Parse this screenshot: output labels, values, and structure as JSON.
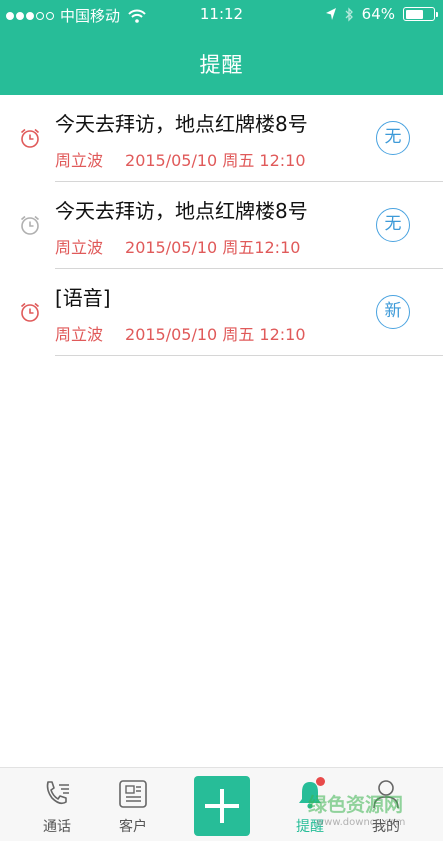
{
  "status_bar": {
    "carrier": "中国移动",
    "time": "11:12",
    "battery": "64%",
    "battery_level": 0.64,
    "signal_dots_on": 3,
    "signal_dots_total": 5
  },
  "header": {
    "title": "提醒"
  },
  "reminders": [
    {
      "title": "今天去拜访，地点红牌楼8号",
      "person": "周立波",
      "datetime": "2015/05/10 周五 12:10",
      "badge": "无",
      "alarm_color": "#e05a5a"
    },
    {
      "title": "今天去拜访，地点红牌楼8号",
      "person": "周立波",
      "datetime": "2015/05/10 周五12:10",
      "badge": "无",
      "alarm_color": "#b0b0b0"
    },
    {
      "title": "[语音]",
      "person": "周立波",
      "datetime": "2015/05/10 周五 12:10",
      "badge": "新",
      "alarm_color": "#e05a5a"
    }
  ],
  "tabbar": {
    "calls": "通话",
    "customers": "客户",
    "reminders": "提醒",
    "mine": "我的"
  },
  "watermark": {
    "text": "绿色资源网",
    "url": "www.downcc.com"
  },
  "colors": {
    "accent": "#27bd98",
    "meta_red": "#e05a5a",
    "badge_blue": "#3d9ad8"
  }
}
